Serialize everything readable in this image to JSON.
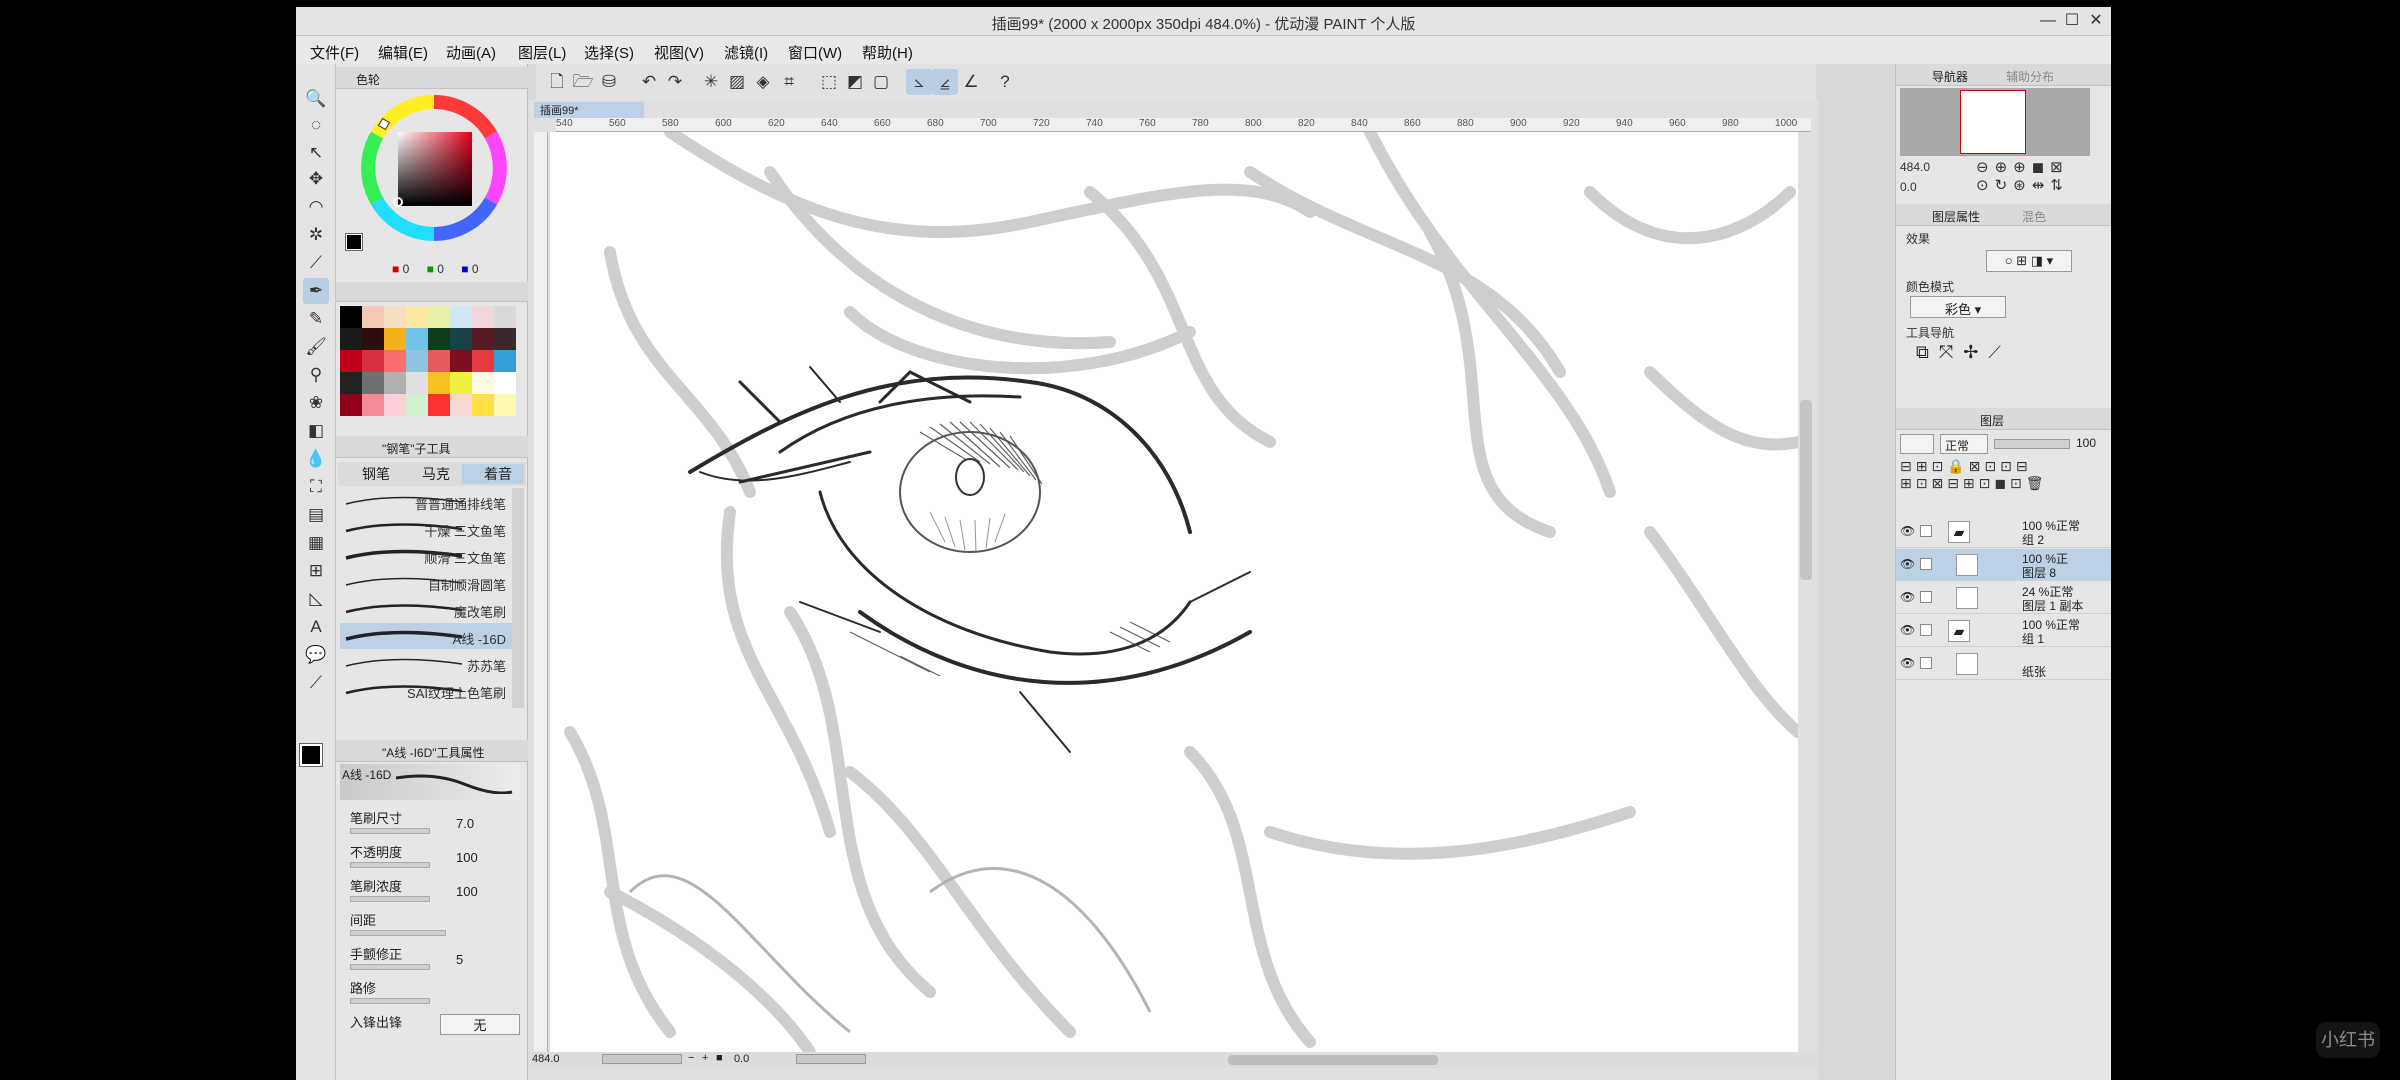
{
  "window": {
    "title": "插画99* (2000 x 2000px 350dpi 484.0%) - 优动漫 PAINT 个人版",
    "minimize": "—",
    "maximize": "☐",
    "close": "✕"
  },
  "menu": [
    "文件(F)",
    "编辑(E)",
    "动画(A)",
    "图层(L)",
    "选择(S)",
    "视图(V)",
    "滤镜(I)",
    "窗口(W)",
    "帮助(H)"
  ],
  "color_panel": {
    "title": "色轮",
    "rgb": {
      "r": "0",
      "g": "0",
      "b": "0"
    }
  },
  "subtool_panel": {
    "title": "\"钢笔\"子工具",
    "tabs": [
      "钢笔",
      "马克",
      "着音"
    ],
    "brushes": [
      "普普通通排线笔",
      "干燥 三文鱼笔",
      "顺滑 三文鱼笔",
      "自制顺滑圆笔",
      "魔改笔刷",
      "A线 -16D",
      "苏苏笔",
      "SAI纹理上色笔刷"
    ],
    "selected_brush_index": 5
  },
  "tool_property": {
    "title": "\"A线 -I6D\"工具属性",
    "brush_name": "A线 -16D",
    "rows": [
      {
        "label": "笔刷尺寸",
        "value": "7.0"
      },
      {
        "label": "不透明度",
        "value": "100"
      },
      {
        "label": "笔刷浓度",
        "value": "100"
      },
      {
        "label": "间距",
        "value": ""
      },
      {
        "label": "手颤修正",
        "value": "5"
      },
      {
        "label": "路修",
        "value": ""
      },
      {
        "label": "入锋出锋",
        "value": "无"
      }
    ]
  },
  "document": {
    "tab": "插画99*",
    "ruler_ticks": [
      "540",
      "560",
      "580",
      "600",
      "620",
      "640",
      "660",
      "680",
      "700",
      "720",
      "740",
      "760",
      "780",
      "800",
      "820",
      "840",
      "860",
      "880",
      "900",
      "920",
      "940",
      "960",
      "980",
      "1000"
    ],
    "zoom": "484.0",
    "angle": "0.0"
  },
  "navigator": {
    "tabs": [
      "导航器",
      "辅助分布"
    ],
    "zoom": "484.0",
    "angle": "0.0"
  },
  "layer_property": {
    "tabs": [
      "图层属性",
      "混色"
    ],
    "effect_label": "效果",
    "color_mode_label": "颜色模式",
    "color_mode_value": "彩色",
    "tool_nav_label": "工具导航"
  },
  "layers_panel": {
    "tab": "图层",
    "blend_mode": "正常",
    "opacity": "100",
    "layers": [
      {
        "line1": "100 %正常",
        "line2": "组 2",
        "type": "folder",
        "selected": false
      },
      {
        "line1": "100 %正",
        "line2": "图层 8",
        "type": "raster",
        "selected": true
      },
      {
        "line1": "24 %正常",
        "line2": "图层 1 副本",
        "type": "raster",
        "selected": false
      },
      {
        "line1": "100 %正常",
        "line2": "组 1",
        "type": "folder",
        "selected": false
      },
      {
        "line1": "",
        "line2": "纸张",
        "type": "paper",
        "selected": false
      }
    ]
  },
  "watermark": "小红书"
}
